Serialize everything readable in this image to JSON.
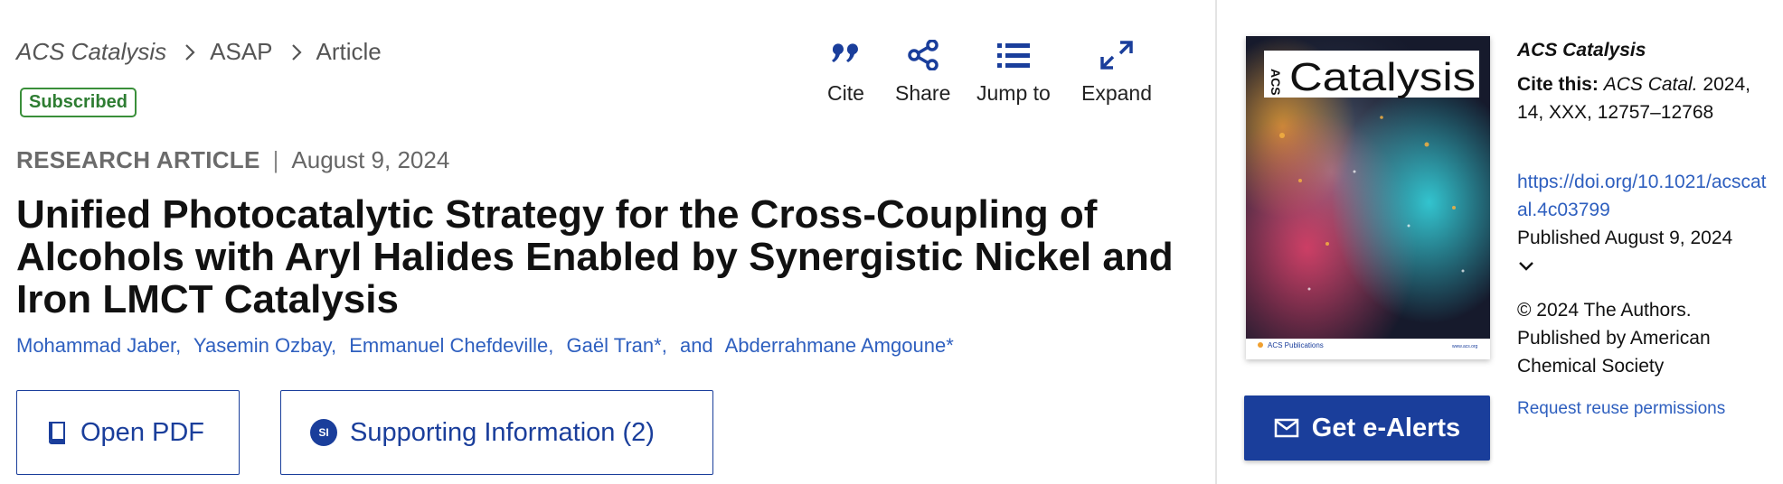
{
  "breadcrumb": {
    "journal": "ACS Catalysis",
    "section": "ASAP",
    "page": "Article"
  },
  "badge": "Subscribed",
  "tools": {
    "cite": "Cite",
    "share": "Share",
    "jump": "Jump to",
    "expand": "Expand"
  },
  "article": {
    "type": "RESEARCH ARTICLE",
    "date": "August 9, 2024",
    "title": "Unified Photocatalytic Strategy for the Cross-Coupling of Alcohols with Aryl Halides Enabled by Synergistic Nickel and Iron LMCT Catalysis",
    "authors": [
      "Mohammad Jaber,",
      "Yasemin Ozbay,",
      "Emmanuel Chefdeville,",
      "Gaël Tran*,",
      "and",
      "Abderrahmane Amgoune*"
    ]
  },
  "buttons": {
    "pdf": "Open PDF",
    "si": "Supporting Information (2)",
    "si_icon": "SI",
    "alerts": "Get e-Alerts"
  },
  "cover": {
    "logo_acs": "ACS",
    "logo_name": "Catalysis",
    "publisher": "ACS Publications",
    "url": "www.acs.org"
  },
  "sidebar": {
    "journal": "ACS Catalysis",
    "cite_label": "Cite this:",
    "cite_journal": "ACS Catal.",
    "cite_rest": "2024, 14, XXX, 12757–12768",
    "doi": "https://doi.org/10.1021/acscatal.4c03799",
    "published": "Published August 9, 2024",
    "copyright": "© 2024 The Authors. Published by American Chemical Society",
    "reuse": "Request reuse permissions"
  },
  "colors": {
    "brand": "#1a3e9b",
    "link": "#2e5fbf",
    "badge": "#2e7d32"
  }
}
